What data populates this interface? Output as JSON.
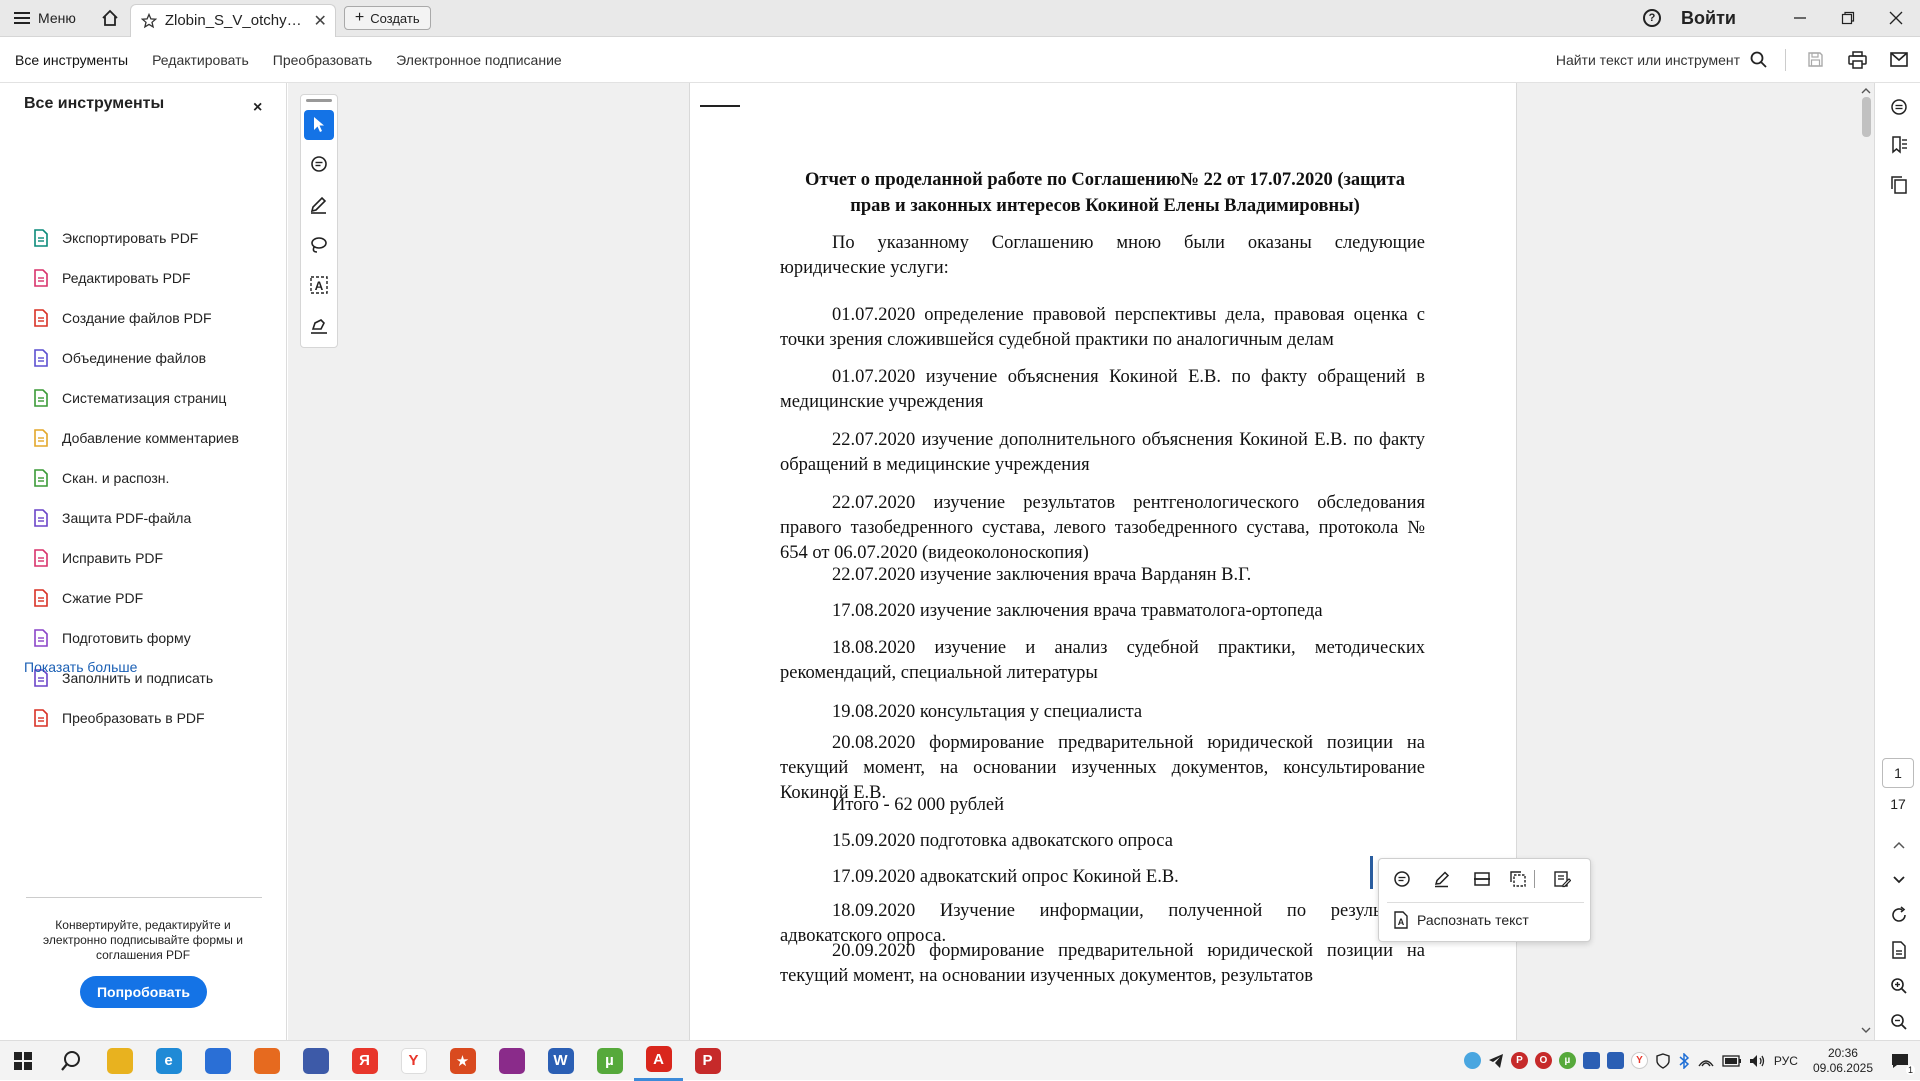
{
  "titlebar": {
    "menu_label": "Меню",
    "tab_title": "Zlobin_S_V_otchyot_...",
    "create_label": "Создать",
    "signin_label": "Войти",
    "help_glyph": "?"
  },
  "menubar": {
    "tabs": [
      "Все инструменты",
      "Редактировать",
      "Преобразовать",
      "Электронное подписание"
    ],
    "find_label": "Найти текст или инструмент"
  },
  "left_panel": {
    "title": "Все инструменты",
    "close_glyph": "×",
    "tools": [
      {
        "label": "Экспортировать PDF",
        "icon": "export-pdf-icon",
        "color": "#0a8a7a"
      },
      {
        "label": "Редактировать PDF",
        "icon": "edit-pdf-icon",
        "color": "#d9326b"
      },
      {
        "label": "Создание файлов PDF",
        "icon": "create-pdf-icon",
        "color": "#d93025"
      },
      {
        "label": "Объединение файлов",
        "icon": "combine-files-icon",
        "color": "#5b4fd0"
      },
      {
        "label": "Систематизация страниц",
        "icon": "organize-pages-icon",
        "color": "#3a9a36"
      },
      {
        "label": "Добавление комментариев",
        "icon": "comment-icon",
        "color": "#e3a72a"
      },
      {
        "label": "Скан. и распозн.",
        "icon": "scan-ocr-icon",
        "color": "#3a9a36"
      },
      {
        "label": "Защита PDF-файла",
        "icon": "protect-pdf-icon",
        "color": "#6a44c8"
      },
      {
        "label": "Исправить PDF",
        "icon": "redact-pdf-icon",
        "color": "#d9326b"
      },
      {
        "label": "Сжатие PDF",
        "icon": "compress-pdf-icon",
        "color": "#d93025"
      },
      {
        "label": "Подготовить форму",
        "icon": "prepare-form-icon",
        "color": "#8a44c8"
      },
      {
        "label": "Заполнить и подписать",
        "icon": "fill-sign-icon",
        "color": "#6a44c8"
      },
      {
        "label": "Преобразовать в PDF",
        "icon": "convert-pdf-icon",
        "color": "#d93025"
      }
    ],
    "show_more": "Показать больше",
    "promo_text": "Конвертируйте, редактируйте и электронно подписывайте формы и соглашения PDF",
    "try_button": "Попробовать"
  },
  "document": {
    "title": "Отчет о проделанной работе по Соглашению№  22 от 17.07.2020 (защита прав и законных интересов Кокиной Елены Владимировны)",
    "paragraphs": [
      "По указанному Соглашению мною были оказаны следующие юридические услуги:",
      "01.07.2020 определение правовой перспективы дела, правовая оценка с точки зрения сложившейся судебной практики по аналогичным делам",
      "01.07.2020 изучение объяснения Кокиной Е.В. по факту обращений в медицинские учреждения",
      "22.07.2020 изучение дополнительного объяснения Кокиной Е.В. по факту обращений в медицинские учреждения",
      "22.07.2020 изучение результатов рентгенологического обследования правого тазобедренного сустава, левого тазобедренного сустава, протокола № 654 от 06.07.2020 (видеоколоноскопия)",
      "22.07.2020 изучение заключения врача Варданян В.Г.",
      "17.08.2020 изучение заключения врача травматолога-ортопеда",
      "18.08.2020 изучение и анализ судебной практики, методических рекомендаций, специальной литературы",
      "19.08.2020 консультация у специалиста",
      "20.08.2020 формирование предварительной юридической позиции на текущий момент, на основании изученных документов, консультирование Кокиной Е.В.",
      "Итого - 62 000 рублей",
      "15.09.2020 подготовка адвокатского опроса",
      "17.09.2020 адвокатский опрос Кокиной Е.В.",
      "18.09.2020 Изучение информации, полученной по результатам адвокатского опроса.",
      "20.09.2020 формирование предварительной юридической позиции на текущий момент, на основании изученных документов, результатов"
    ]
  },
  "popup": {
    "recognize_label": "Распознать текст"
  },
  "right_rail": {
    "current_page": "1",
    "total_pages": "17"
  },
  "taskbar": {
    "apps": [
      {
        "name": "file-explorer-icon",
        "color": "#e8b21f",
        "glyph": ""
      },
      {
        "name": "edge-icon",
        "color": "#1f8ad6",
        "glyph": "e"
      },
      {
        "name": "store-icon",
        "color": "#2a6fd6",
        "glyph": ""
      },
      {
        "name": "firefox-icon",
        "color": "#e66a1f",
        "glyph": ""
      },
      {
        "name": "shield-app-icon",
        "color": "#3d5aa8",
        "glyph": ""
      },
      {
        "name": "yandex-icon",
        "color": "#e8362b",
        "glyph": "Я"
      },
      {
        "name": "yandex-browser-icon",
        "color": "#ffffff",
        "glyph": "Y"
      },
      {
        "name": "shield-star-icon",
        "color": "#d94a1f",
        "glyph": "★"
      },
      {
        "name": "winrar-icon",
        "color": "#8a2b8a",
        "glyph": ""
      },
      {
        "name": "word-icon",
        "color": "#2b5fb4",
        "glyph": "W"
      },
      {
        "name": "utorrent-icon",
        "color": "#56a93b",
        "glyph": "µ"
      },
      {
        "name": "acrobat-icon",
        "color": "#d9261c",
        "glyph": "A"
      },
      {
        "name": "p-app-icon",
        "color": "#c62a2a",
        "glyph": "P"
      }
    ],
    "lang": "РУС",
    "time": "20:36",
    "date": "09.06.2025",
    "notification_count": "1"
  }
}
